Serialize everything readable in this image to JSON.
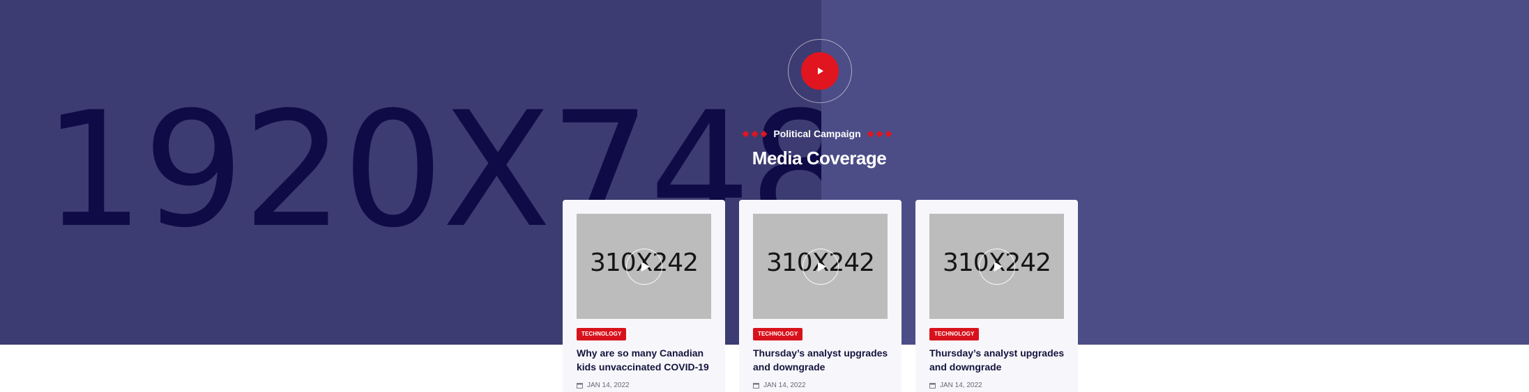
{
  "hero": {
    "placeholder_label": "1920X748",
    "play_icon": "play-icon",
    "subtitle": "Political Campaign",
    "heading": "Media Coverage"
  },
  "cards": [
    {
      "thumb_label": "310X242",
      "tag": "TECHNOLOGY",
      "title": "Why are so many Canadian kids unvaccinated COVID-19",
      "date": "JAN 14, 2022"
    },
    {
      "thumb_label": "310X242",
      "tag": "TECHNOLOGY",
      "title": "Thursday’s analyst upgrades and downgrade",
      "date": "JAN 14, 2022"
    },
    {
      "thumb_label": "310X242",
      "tag": "TECHNOLOGY",
      "title": "Thursday’s analyst upgrades and downgrade",
      "date": "JAN 14, 2022"
    }
  ],
  "colors": {
    "hero_left": "#3c3c72",
    "hero_right": "#4c4d87",
    "accent_red": "#e0151f",
    "card_bg": "#f7f7fb",
    "title_text": "#14133d"
  }
}
